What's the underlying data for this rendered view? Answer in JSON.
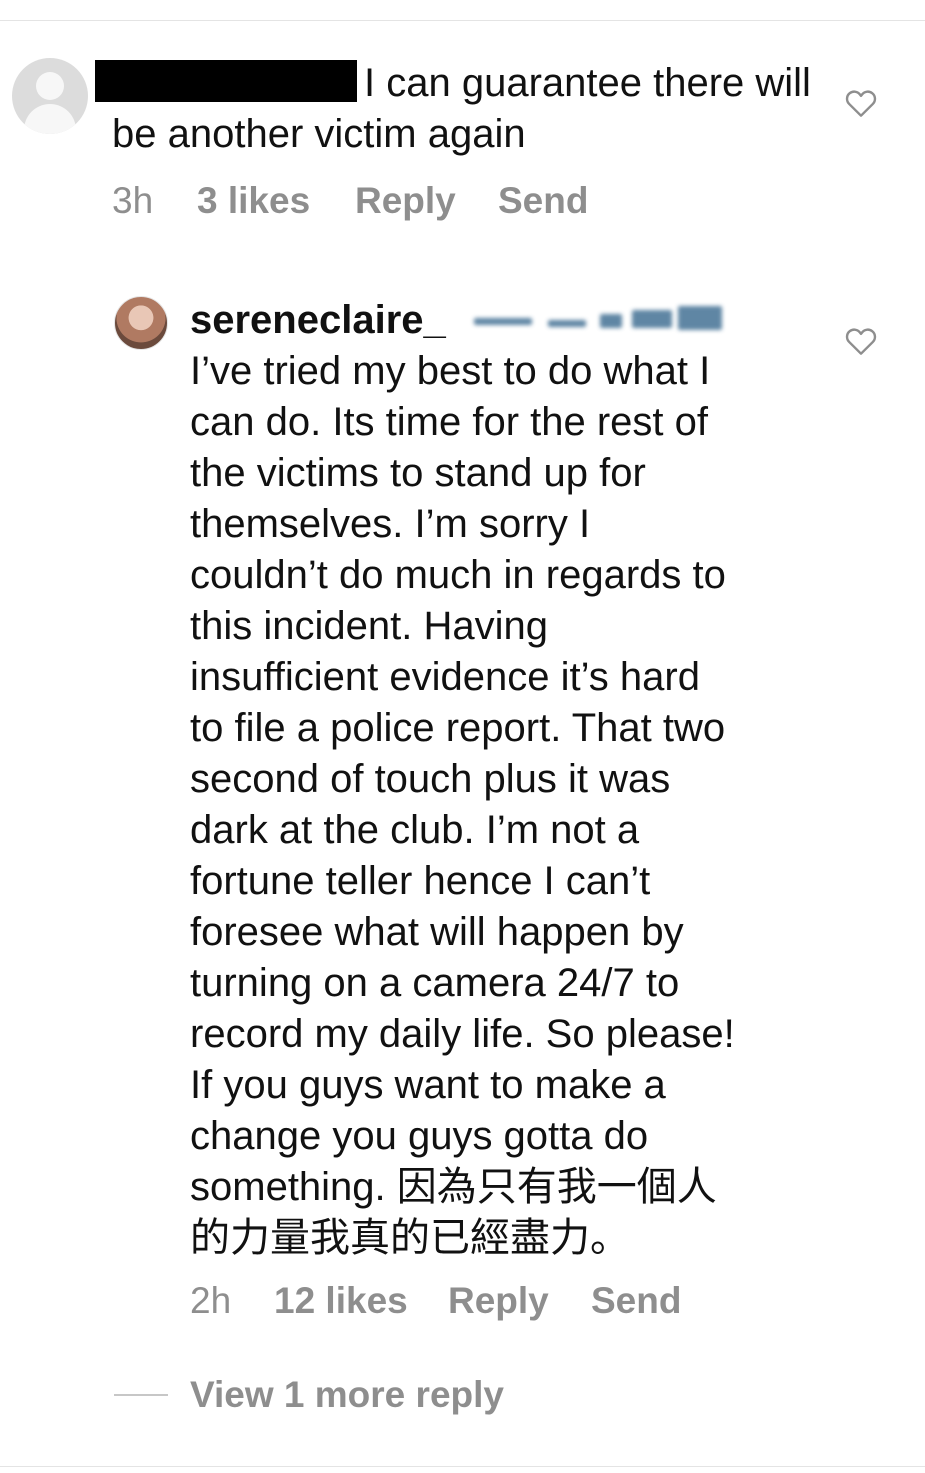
{
  "comment_1": {
    "text": "I can guarantee there will be another victim again",
    "time": "3h",
    "likes": "3 likes",
    "reply_label": "Reply",
    "send_label": "Send"
  },
  "comment_2": {
    "username": "sereneclaire_",
    "text_lines": [
      "I’ve tried my best to do what I",
      "can do. Its time for the rest of",
      "the victims to stand up for",
      "themselves. I’m sorry I",
      "couldn’t do much in regards to",
      "this incident. Having",
      "insufficient evidence it’s hard",
      "to file a police report. That two",
      "second of touch plus it was",
      "dark at the club. I’m not a",
      "fortune teller hence I can’t",
      "foresee what will happen by",
      "turning on a camera 24/7 to",
      "record my daily life. So please!",
      "If you guys want to make a",
      "change you guys gotta do",
      "something. 因為只有我一個人",
      "的力量我真的已經盡力。"
    ],
    "time": "2h",
    "likes": "12 likes",
    "reply_label": "Reply",
    "send_label": "Send"
  },
  "view_more_replies": "View 1 more reply",
  "colors": {
    "text": "#111111",
    "meta": "#8e8e8e",
    "redaction": "#000000"
  },
  "icons": {
    "like": "heart-outline-icon",
    "avatar_default": "default-avatar-icon"
  }
}
